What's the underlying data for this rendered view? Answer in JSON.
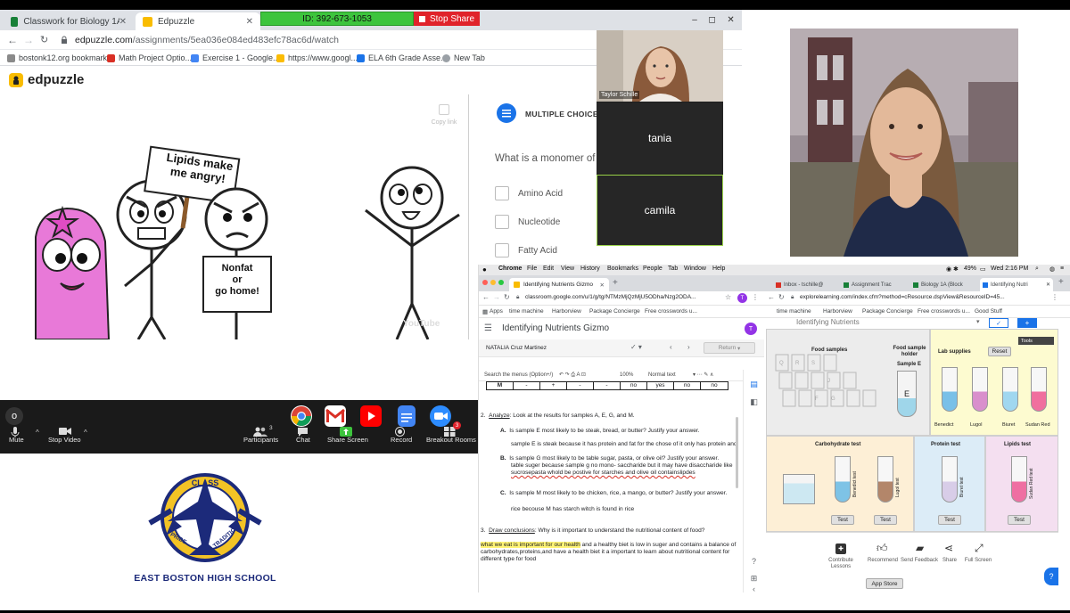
{
  "browser": {
    "tabs": [
      {
        "label": "Classwork for Biology 1A (Block"
      },
      {
        "label": "Edpuzzle"
      }
    ],
    "url_host": "edpuzzle.com",
    "url_path": "/assignments/5ea036e084ed483efc78ac6d/watch",
    "bookmarks": [
      "bostonk12.org bookmarks",
      "Math Project Optio...",
      "Exercise 1 - Google...",
      "https://www.googl...",
      "ELA 6th Grade Asse...",
      "New Tab"
    ],
    "screen_share_id": "ID: 392-673-1053",
    "stop_share_label": "Stop Share"
  },
  "edpuzzle": {
    "logo": "edpuzzle",
    "video": {
      "sign_left": "Lipids make me angry!",
      "sign_right_1": "Nonfat",
      "sign_right_2": "or",
      "sign_right_3": "go home!",
      "copy_link": "Copy link",
      "watermark": "YouTube"
    },
    "quiz": {
      "header": "MULTIPLE CHOICE QU",
      "question": "What is a monomer of",
      "options": [
        "Amino Acid",
        "Nucleotide",
        "Fatty Acid"
      ]
    }
  },
  "zoom": {
    "participants": {
      "self_name": "Taylor Schille",
      "others": [
        "tania",
        "camila"
      ]
    },
    "participants_count": "3",
    "breakout_count": "3",
    "toolbar": {
      "mute": "Mute",
      "stop_video": "Stop Video",
      "participants": "Participants",
      "chat": "Chat",
      "share_screen": "Share Screen",
      "record": "Record",
      "breakout_rooms": "Breakout Rooms"
    }
  },
  "school": {
    "logo_top": "CLASS",
    "logo_left": "PRIDE",
    "logo_right": "TRADITION",
    "name": "EAST BOSTON HIGH SCHOOL"
  },
  "mac": {
    "menu": [
      "Chrome",
      "File",
      "Edit",
      "View",
      "History",
      "Bookmarks",
      "People",
      "Tab",
      "Window",
      "Help"
    ],
    "battery": "49%",
    "clock": "Wed 2:16 PM"
  },
  "docs_window": {
    "tab": "Identifying Nutrients Gizmo",
    "url": "classroom.google.com/u/1/g/tg/NTMzMjQzMjU5ODha/Nzg2ODA...",
    "bookmarks": [
      "Apps",
      "time machine",
      "Harborview",
      "Package Concierge",
      "Free crosswords u..."
    ],
    "doc_title": "Identifying Nutrients Gizmo",
    "student_name": "NATALIA Cruz Martinez",
    "return_label": "Return",
    "toolbar_search": "Search the menus (Option+/)",
    "zoom": "100%",
    "style": "Normal text",
    "table_row": [
      "M",
      "-",
      "+",
      "-",
      "-",
      "no",
      "yes",
      "no",
      "no"
    ],
    "body": {
      "q2_num": "2.",
      "q2_lead": "Analyze",
      "q2_text": ": Look at the results for samples A, E, G, and M.",
      "qa_label": "A.",
      "qa": "Is sample E most likely to be steak, bread, or butter? Justify your answer.",
      "qa_ans": "sample E is steak because it has protein and fat for the chose of it only has protein and",
      "qb_label": "B.",
      "qb": "Is sample G most likely to be table sugar, pasta, or olive oil? Justify your answer.",
      "qb_ans_1": "table suger because sample g no mono- saccharide  but it may have disaccharide like",
      "qb_ans_2": "sucrosepasta whold be postive for starches and olive oil containslipdes",
      "qc_label": "C.",
      "qc": "Is sample M most likely to be chicken, rice, a mango, or butter? Justify your answer.",
      "qc_ans": "rice becouse M has starch witch is found in rice",
      "q3_num": "3.",
      "q3_lead": "Draw conclusions",
      "q3_text": ": Why is it important to understand the nutritional content of food?",
      "q3_hl": "what we eat is important for our health",
      "q3_rest_1": " and a healthy biet is low in suger and contains a balance of",
      "q3_rest_2": "carbohydrates,proteins,and have a health biet it a important to learn about nutritional content for",
      "q3_rest_3": "different type for food"
    }
  },
  "gizmo_window": {
    "tabs": [
      "Inbox - tschille@",
      "Assignment Trac",
      "Biology 1A (Block",
      "Identifying Nutri"
    ],
    "url": "explorelearning.com/index.cfm?method=cResource.dspView&ResourceID=45...",
    "bookmarks": [
      "time machine",
      "Harborview",
      "Package Concierge",
      "Free crosswords u...",
      "Good Stuff"
    ],
    "title": "Identifying Nutrients",
    "food_samples": "Food samples",
    "sample_holder": "Food sample holder",
    "sample_label": "Sample E",
    "sample_letter": "E",
    "lab_supplies": "Lab supplies",
    "reset": "Reset",
    "tools": "Tools",
    "reagents": [
      "Benedict",
      "Lugol",
      "Biuret",
      "Sudan Red"
    ],
    "tests": [
      "Carbohydrate test",
      "Protein test",
      "Lipids test"
    ],
    "tube_labels": [
      "Benedict test",
      "Lugol test",
      "Biuret test",
      "Sudan Red test"
    ],
    "test_button": "Test",
    "footer": [
      "Contribute Lessons",
      "Recommend",
      "Send Feedback",
      "Share",
      "Full Screen"
    ],
    "app_store": "App Store"
  },
  "colors": {
    "zoom_green": "#3dc43d",
    "stop_red": "#e0232b",
    "navy": "#1c2a7a",
    "docs_blue": "#1a73e8"
  }
}
